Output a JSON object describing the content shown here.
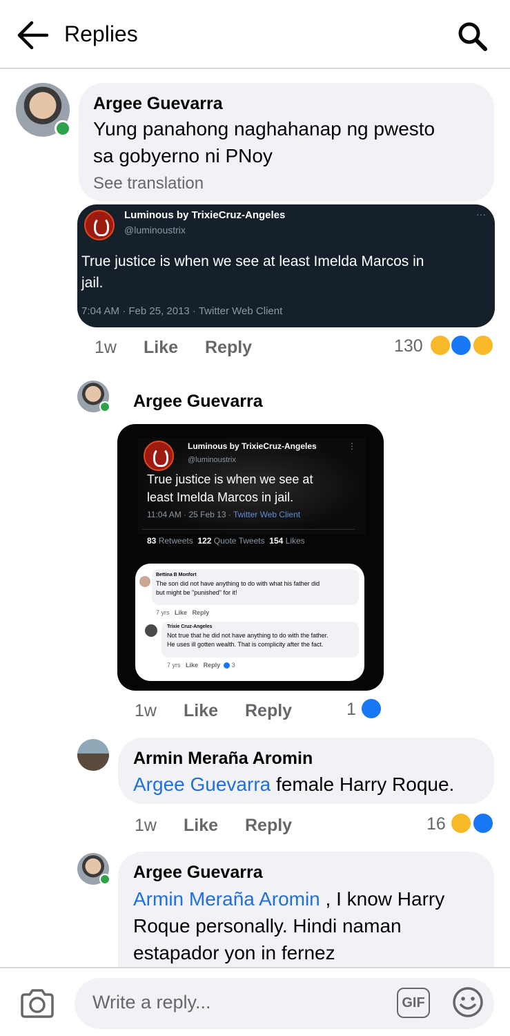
{
  "header": {
    "title": "Replies"
  },
  "comments": [
    {
      "author": "Argee Guevarra",
      "text_line1": "Yung panahong naghahanap ng pwesto",
      "text_line2": "sa gobyerno ni PNoy",
      "see_translation": "See translation",
      "time": "1w",
      "like": "Like",
      "reply": "Reply",
      "reaction_count": "130",
      "reactions": [
        "haha",
        "like",
        "wow"
      ]
    },
    {
      "author": "Argee Guevarra",
      "time": "1w",
      "like": "Like",
      "reply": "Reply",
      "reaction_count": "1",
      "reactions": [
        "like"
      ]
    },
    {
      "author": "Armin Meraña Aromin",
      "mention": "Argee Guevarra",
      "text": " female Harry Roque.",
      "time": "1w",
      "like": "Like",
      "reply": "Reply",
      "reaction_count": "16",
      "reactions": [
        "haha",
        "like"
      ]
    },
    {
      "author": "Argee Guevarra",
      "mention": "Armin Meraña Aromin",
      "text_after_mention": " , I know Harry",
      "text_line2": "Roque personally. Hindi naman",
      "text_line3": "estapador yon in fernez"
    }
  ],
  "tweet": {
    "name": "Luminous by TrixieCruz-Angeles",
    "handle": "@luminoustrix",
    "more": "···",
    "text_line1": "True justice is when we see at least Imelda Marcos in",
    "text_line2": "jail.",
    "meta": "7:04 AM · Feb 25, 2013 · Twitter Web Client"
  },
  "screenshot": {
    "name": "Luminous by TrixieCruz-Angeles",
    "handle": "@luminoustrix",
    "more": "⋮",
    "text_line1": "True justice is when we see at",
    "text_line2": "least Imelda Marcos in jail.",
    "meta_time": "11:04 AM · 25 Feb 13 · ",
    "meta_client": "Twitter Web Client",
    "retweets_num": "83",
    "retweets_label": "Retweets",
    "quotes_num": "122",
    "quotes_label": "Quote Tweets",
    "likes_num": "154",
    "likes_label": "Likes",
    "fb1_author": "Bettina B Monfort",
    "fb1_line1": "The son did not have anything to do with what his father did",
    "fb1_line2": "but might be \"punished\" for it!",
    "fb1_time": "7 yrs",
    "fb1_like": "Like",
    "fb1_reply": "Reply",
    "fb2_author": "Trixie Cruz-Angeles",
    "fb2_line1": "Not true that he did not have anything to do with the father.",
    "fb2_line2": "He uses ill gotten wealth. That is complicity after the fact.",
    "fb2_time": "7 yrs",
    "fb2_like": "Like",
    "fb2_reply": "Reply",
    "fb2_count": "3"
  },
  "composer": {
    "placeholder": "Write a reply...",
    "gif_label": "GIF"
  },
  "colors": {
    "link": "#216fdb",
    "bubble": "#f0f2f5",
    "online": "#31a24c",
    "like_blue": "#1877f2",
    "haha_yellow": "#f7b928"
  }
}
